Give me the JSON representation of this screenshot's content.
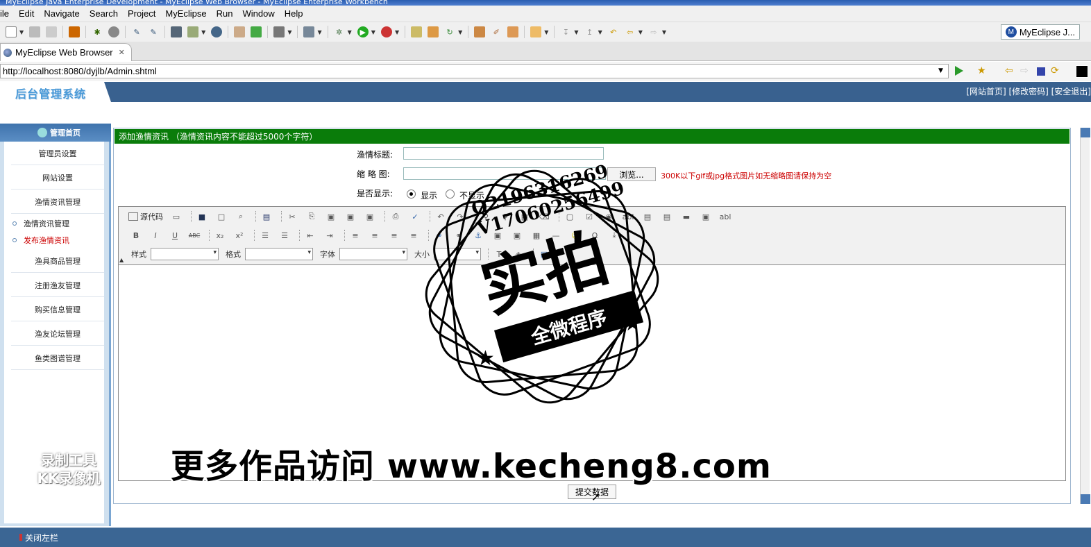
{
  "window_title": "MyEclipse Java Enterprise Development - MyEclipse Web Browser - MyEclipse Enterprise Workbench",
  "menu": [
    "ile",
    "Edit",
    "Navigate",
    "Search",
    "Project",
    "MyEclipse",
    "Run",
    "Window",
    "Help"
  ],
  "perspective_label": "MyEclipse J...",
  "editor_tab": "MyEclipse Web Browser",
  "url": "http://localhost:8080/dyjlb/Admin.shtml",
  "admin": {
    "logo": "后台管理系统",
    "header_links": "[网站首页] [修改密码] [安全退出]",
    "nav_home": "管理首页",
    "nav": {
      "admin_settings": "管理员设置",
      "site_settings": "网站设置",
      "fish_news_mgmt": "渔情资讯管理",
      "fish_news_manage_sub": "渔情资讯管理",
      "fish_news_publish_sub": "发布渔情资讯",
      "gear_mgmt": "渔具商品管理",
      "user_mgmt": "注册渔友管理",
      "purchase_mgmt": "购买信息管理",
      "forum_mgmt": "渔友论坛管理",
      "fish_atlas_mgmt": "鱼类图谱管理"
    },
    "form": {
      "section_title": "添加渔情资讯 （渔情资讯内容不能超过5000个字符）",
      "title_label": "渔情标题:",
      "thumb_label": "缩 略 图:",
      "browse": "浏览...",
      "thumb_hint": "300K以下gif或jpg格式图片如无缩略图请保持为空",
      "display_label": "是否显示:",
      "show": "显示",
      "hide": "不显示",
      "submit": "提交数据"
    },
    "editor": {
      "source": "源代码",
      "style_label": "样式",
      "format_label": "格式",
      "font_label": "字体",
      "size_label": "大小"
    },
    "close_left": "关闭左栏"
  },
  "watermarks": {
    "stamp_qq": "Q2196316269",
    "stamp_v": "V17060256499",
    "stamp_big": "实拍",
    "stamp_band": "全微程序",
    "site": "更多作品访问 www.kecheng8.com",
    "recorder_line1": "录制工具",
    "recorder_line2": "KK录像机"
  },
  "colors": {
    "header_blue": "#39618f",
    "section_green": "#0a7c0a",
    "hint_red": "#cc0000"
  }
}
